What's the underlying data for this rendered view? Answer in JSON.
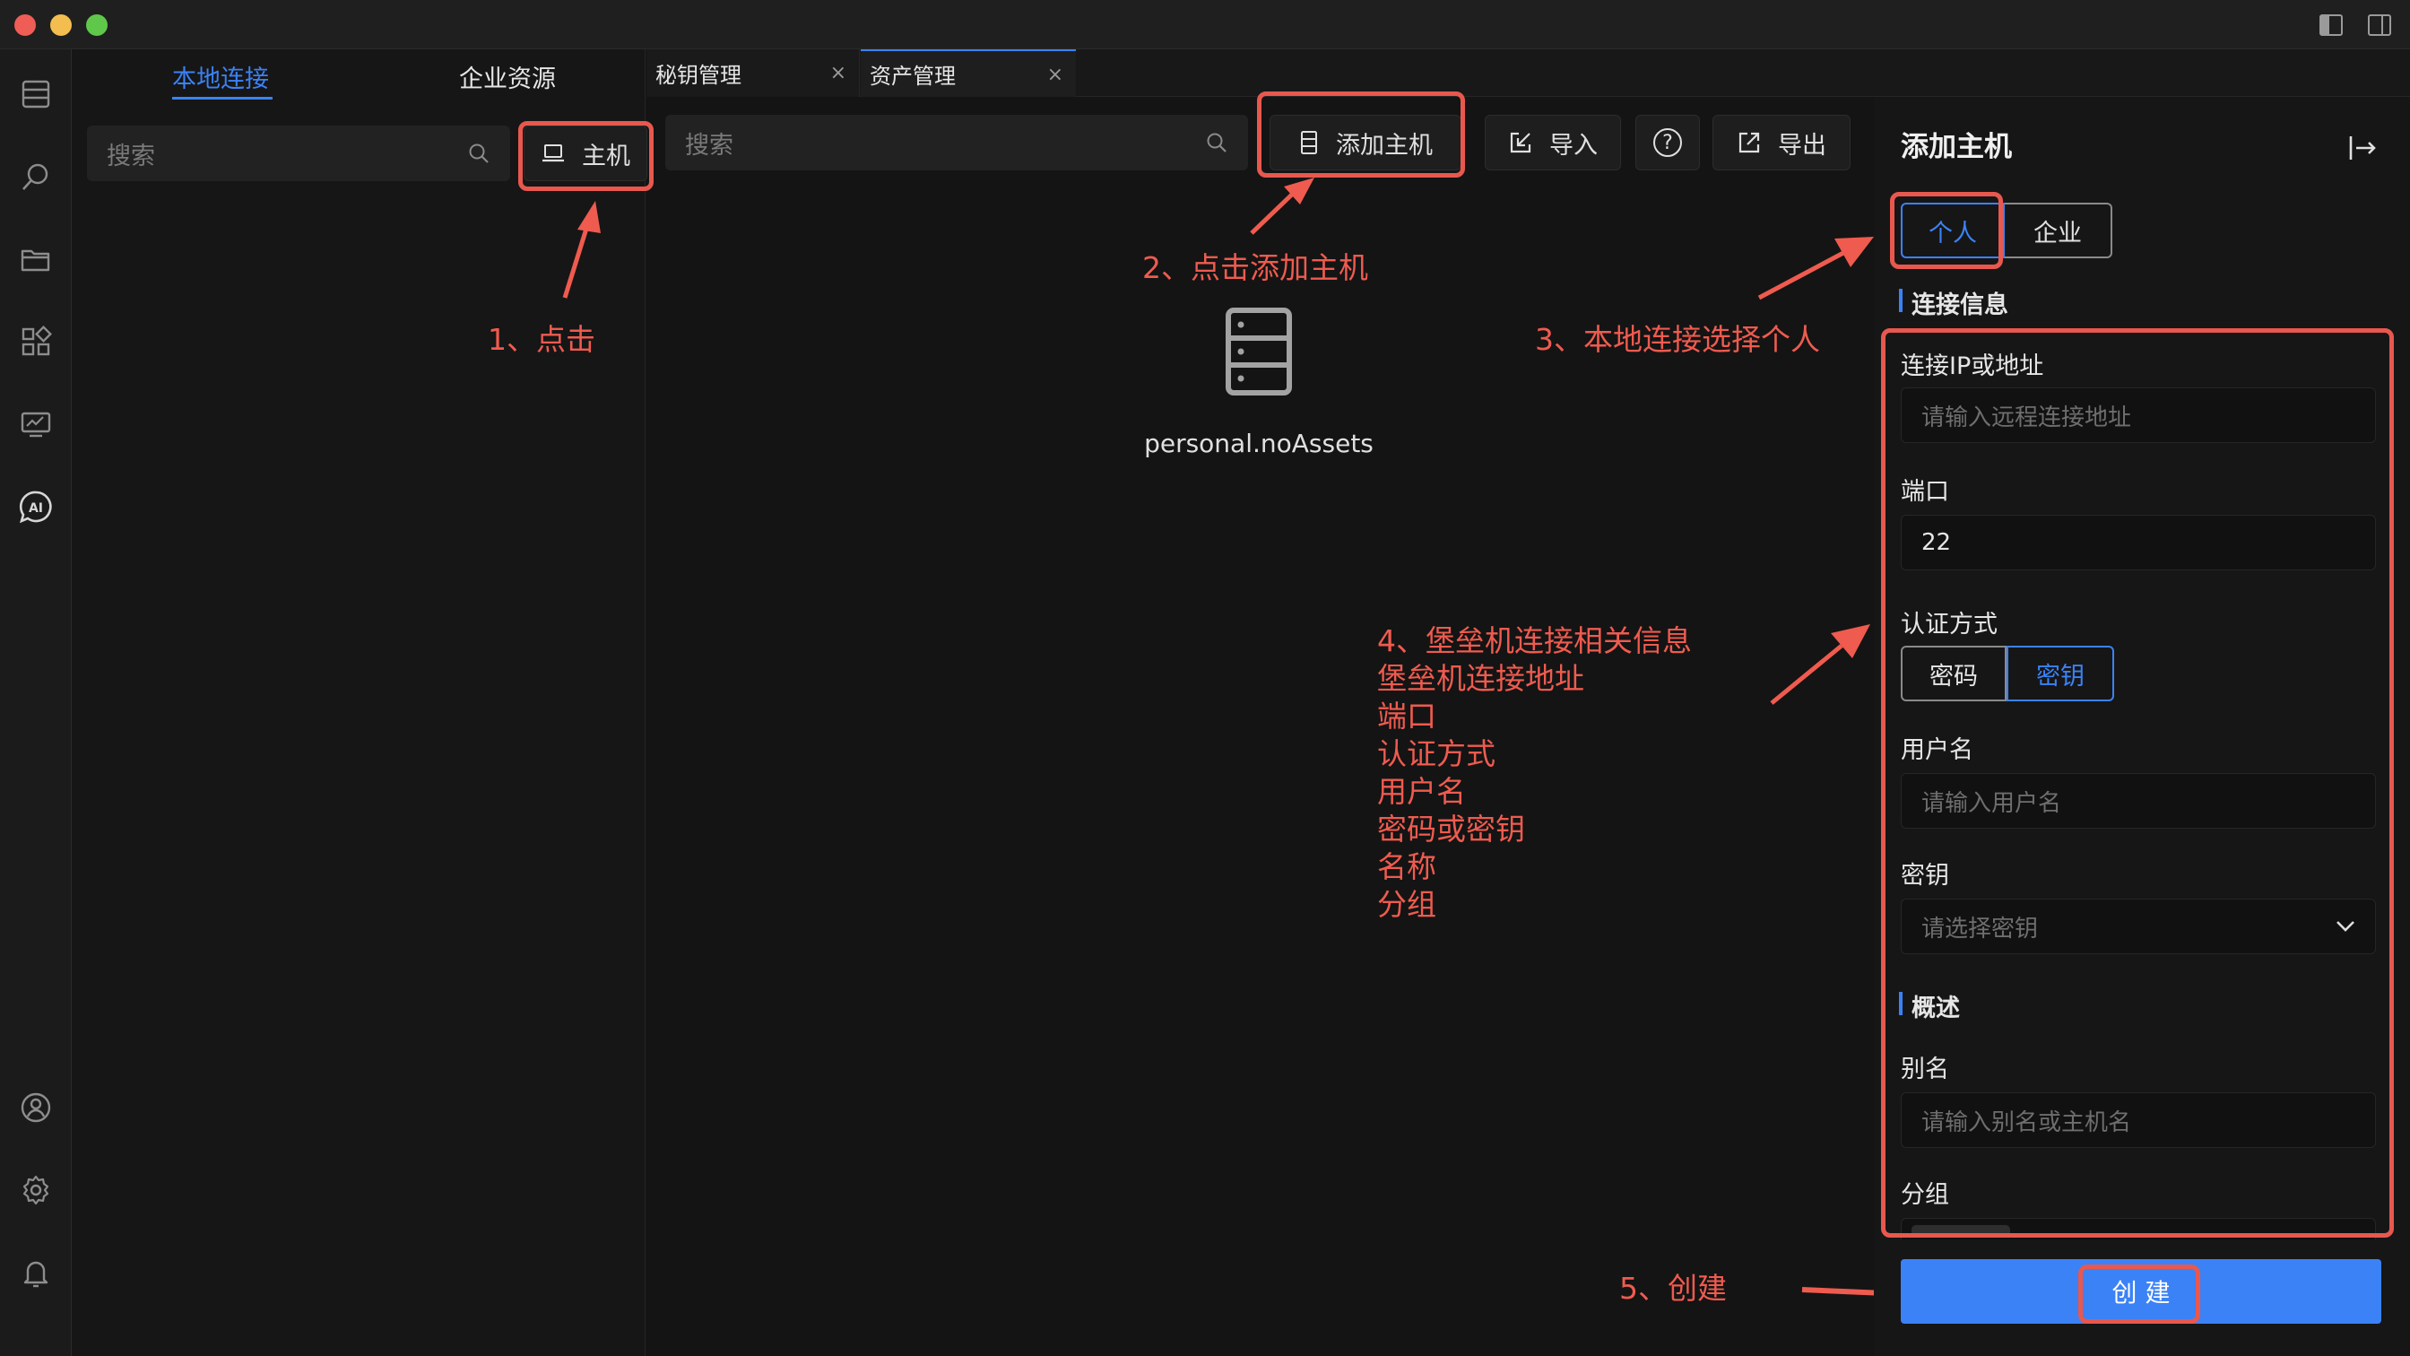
{
  "window": {
    "traffic_lights": [
      "#ee5e56",
      "#f4bd4f",
      "#5fc84b"
    ]
  },
  "left_panel": {
    "tabs": [
      "本地连接",
      "企业资源"
    ],
    "search_placeholder": "搜索",
    "host_button": "主机"
  },
  "editor_tabs": [
    {
      "label": "秘钥管理",
      "close": "×"
    },
    {
      "label": "资产管理",
      "close": "×"
    }
  ],
  "toolbar": {
    "search_placeholder": "搜索",
    "add_host": "添加主机",
    "import": "导入",
    "help": "?",
    "export": "导出"
  },
  "empty_state": {
    "text": "personal.noAssets"
  },
  "drawer": {
    "title": "添加主机",
    "type_options": [
      "个人",
      "企业"
    ],
    "section_connection": "连接信息",
    "ip_label": "连接IP或地址",
    "ip_placeholder": "请输入远程连接地址",
    "port_label": "端口",
    "port_value": "22",
    "auth_label": "认证方式",
    "auth_options": [
      "密码",
      "密钥"
    ],
    "username_label": "用户名",
    "username_placeholder": "请输入用户名",
    "key_label": "密钥",
    "key_placeholder": "请选择密钥",
    "section_overview": "概述",
    "alias_label": "别名",
    "alias_placeholder": "请输入别名或主机名",
    "group_label": "分组",
    "create_button": "创 建"
  },
  "annotations": {
    "step1": "1、点击",
    "step2": "2、点击添加主机",
    "step3": "3、本地连接选择个人",
    "step4_lines": [
      "4、堡垒机连接相关信息",
      "堡垒机连接地址",
      "端口",
      "认证方式",
      "用户名",
      "密码或密钥",
      "名称",
      "分组"
    ],
    "step5": "5、创建"
  },
  "colors": {
    "accent": "#3b82f6",
    "annotation": "#ef5b4f",
    "background": "#141414"
  }
}
